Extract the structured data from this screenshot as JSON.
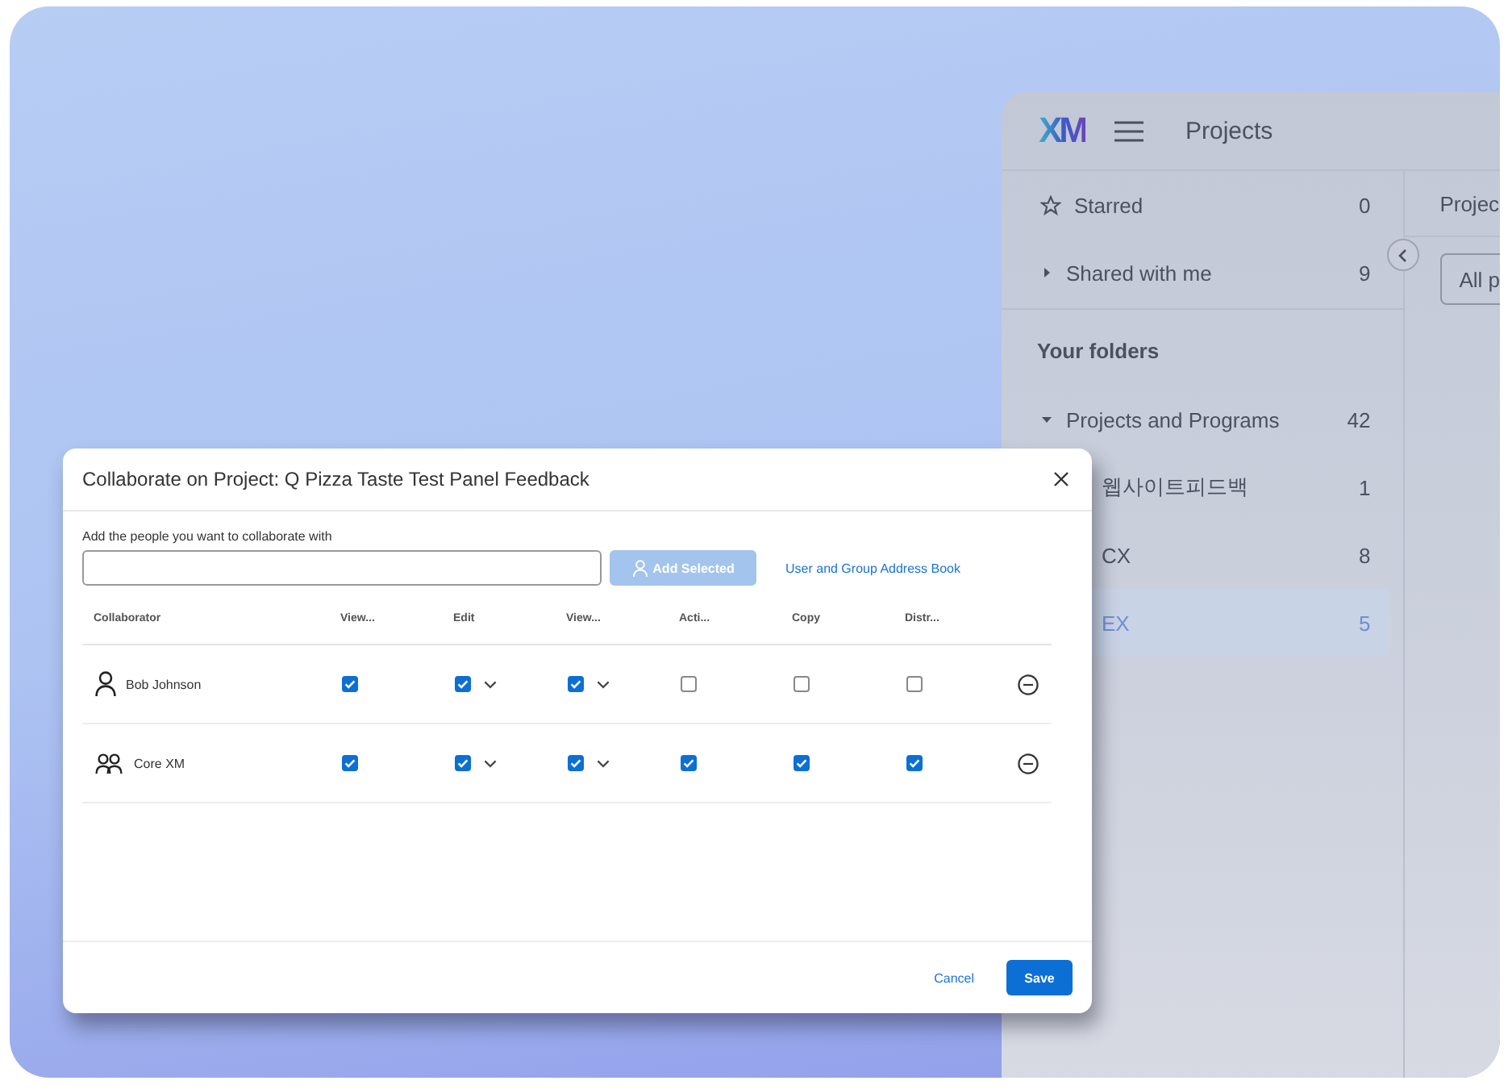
{
  "app": {
    "logo": "XM",
    "title": "Projects",
    "tab": "Projec",
    "filter": "All p",
    "nav": [
      {
        "label": "Starred",
        "count": "0",
        "kind": "star"
      },
      {
        "label": "Shared with me",
        "count": "9",
        "kind": "toggle",
        "expanded": false
      }
    ],
    "folders_heading": "Your folders",
    "folders": [
      {
        "label": "Projects and Programs",
        "count": "42",
        "expanded": true,
        "selected": false,
        "children": [
          {
            "label": "웹사이트피드백",
            "count": "1",
            "selected": false
          },
          {
            "label": "CX",
            "count": "8",
            "selected": false
          },
          {
            "label": "EX",
            "count": "5",
            "selected": true
          }
        ]
      }
    ]
  },
  "dialog": {
    "title": "Collaborate on Project: Q Pizza Taste Test Panel Feedback",
    "field_label": "Add the people you want to collaborate with",
    "add_button": {
      "label": "Add Selected",
      "disabled": true
    },
    "address_book_link": "User and Group Address Book",
    "columns": [
      "Collaborator",
      "View...",
      "Edit",
      "View...",
      "Acti...",
      "Copy",
      "Distr..."
    ],
    "rows": [
      {
        "name": "Bob Johnson",
        "kind": "user",
        "permissions": [
          {
            "checked": true,
            "dropdown": false
          },
          {
            "checked": true,
            "dropdown": true
          },
          {
            "checked": true,
            "dropdown": true
          },
          {
            "checked": false,
            "dropdown": false
          },
          {
            "checked": false,
            "dropdown": false
          },
          {
            "checked": false,
            "dropdown": false
          }
        ]
      },
      {
        "name": "Core XM",
        "kind": "group",
        "permissions": [
          {
            "checked": true,
            "dropdown": false
          },
          {
            "checked": true,
            "dropdown": true
          },
          {
            "checked": true,
            "dropdown": true
          },
          {
            "checked": true,
            "dropdown": false
          },
          {
            "checked": true,
            "dropdown": false
          },
          {
            "checked": true,
            "dropdown": false
          }
        ]
      }
    ],
    "cancel": "Cancel",
    "save": "Save"
  }
}
